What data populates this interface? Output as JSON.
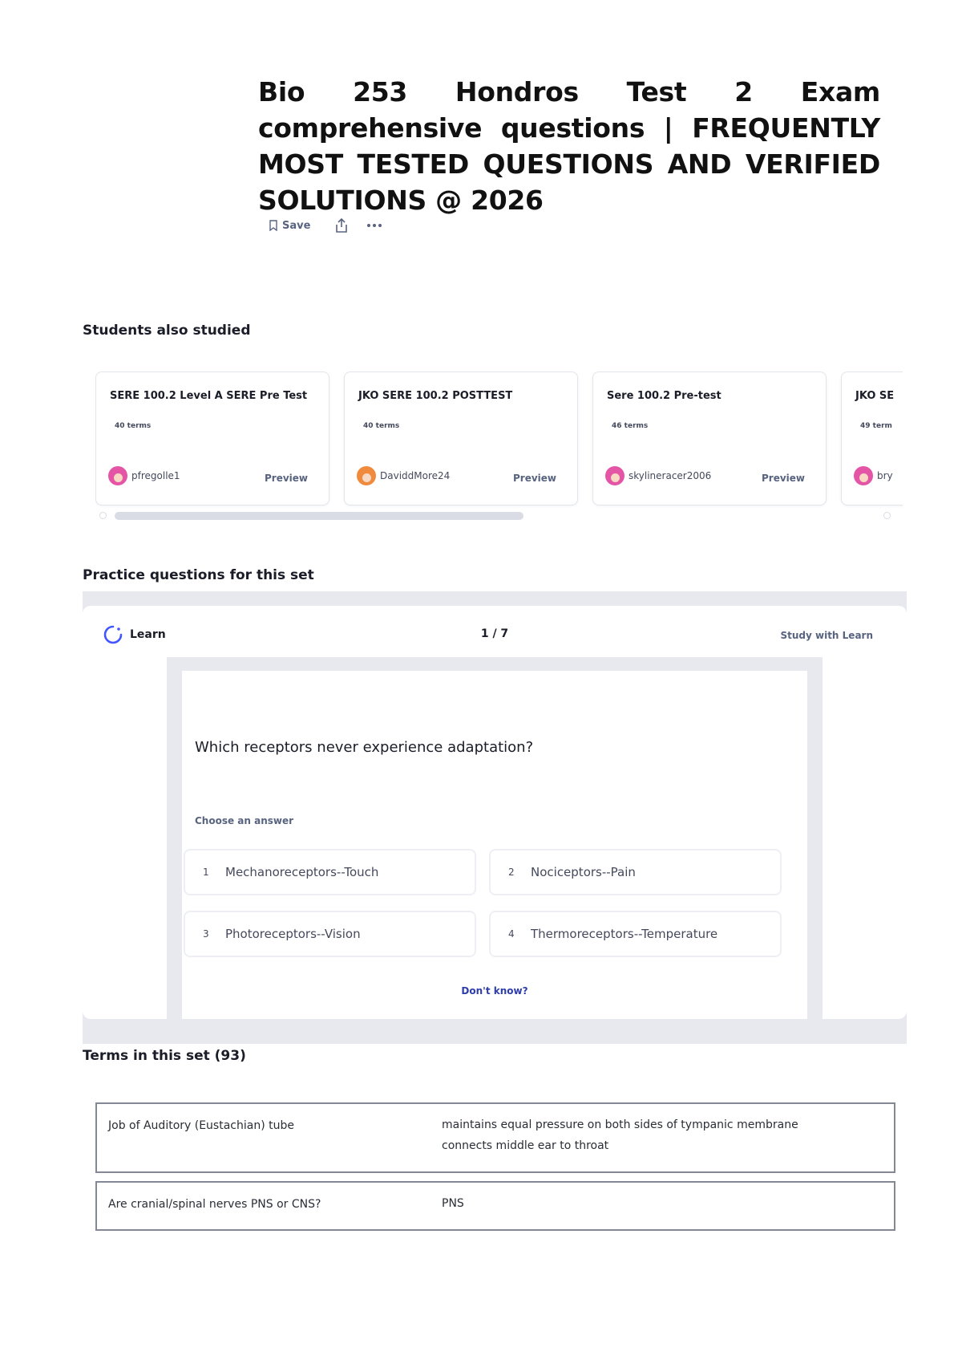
{
  "title": "Bio 253 Hondros Test 2 Exam comprehensive questions | FREQUENTLY MOST TESTED QUESTIONS AND VERIFIED SOLUTIONS @ 2026",
  "actions": {
    "save_label": "Save",
    "share_icon": "share-icon",
    "more_icon": "more-icon"
  },
  "students_also_studied": {
    "heading": "Students also studied",
    "cards": [
      {
        "title": "SERE 100.2 Level A SERE Pre Test",
        "terms": "40 terms",
        "user": "pfregolle1",
        "preview": "Preview"
      },
      {
        "title": "JKO SERE 100.2 POSTTEST",
        "terms": "40 terms",
        "user": "DaviddMore24",
        "preview": "Preview"
      },
      {
        "title": "Sere 100.2 Pre-test",
        "terms": "46 terms",
        "user": "skylineracer2006",
        "preview": "Preview"
      },
      {
        "title": "JKO SE",
        "terms": "49 term",
        "user": "bry",
        "preview": ""
      }
    ]
  },
  "practice": {
    "heading": "Practice questions for this set",
    "learn_label": "Learn",
    "progress": "1 / 7",
    "study_link": "Study with Learn",
    "question": "Which receptors never experience adaptation?",
    "choose_label": "Choose an answer",
    "answers": [
      {
        "num": "1",
        "text": "Mechanoreceptors--Touch"
      },
      {
        "num": "2",
        "text": "Nociceptors--Pain"
      },
      {
        "num": "3",
        "text": "Photoreceptors--Vision"
      },
      {
        "num": "4",
        "text": "Thermoreceptors--Temperature"
      }
    ],
    "dont_know": "Don't know?"
  },
  "terms": {
    "heading": "Terms in this set (93)",
    "rows": [
      {
        "term": "Job of Auditory (Eustachian) tube",
        "definition_lines": [
          "maintains equal pressure on both sides of tympanic membrane",
          "connects middle ear to throat"
        ]
      },
      {
        "term": "Are cranial/spinal nerves PNS or CNS?",
        "definition_lines": [
          "PNS"
        ]
      }
    ]
  },
  "colors": {
    "accent": "#2e3dad",
    "muted": "#586380",
    "text": "#1a1d28",
    "panel_bg": "#e8e9ee",
    "border": "#848895"
  }
}
